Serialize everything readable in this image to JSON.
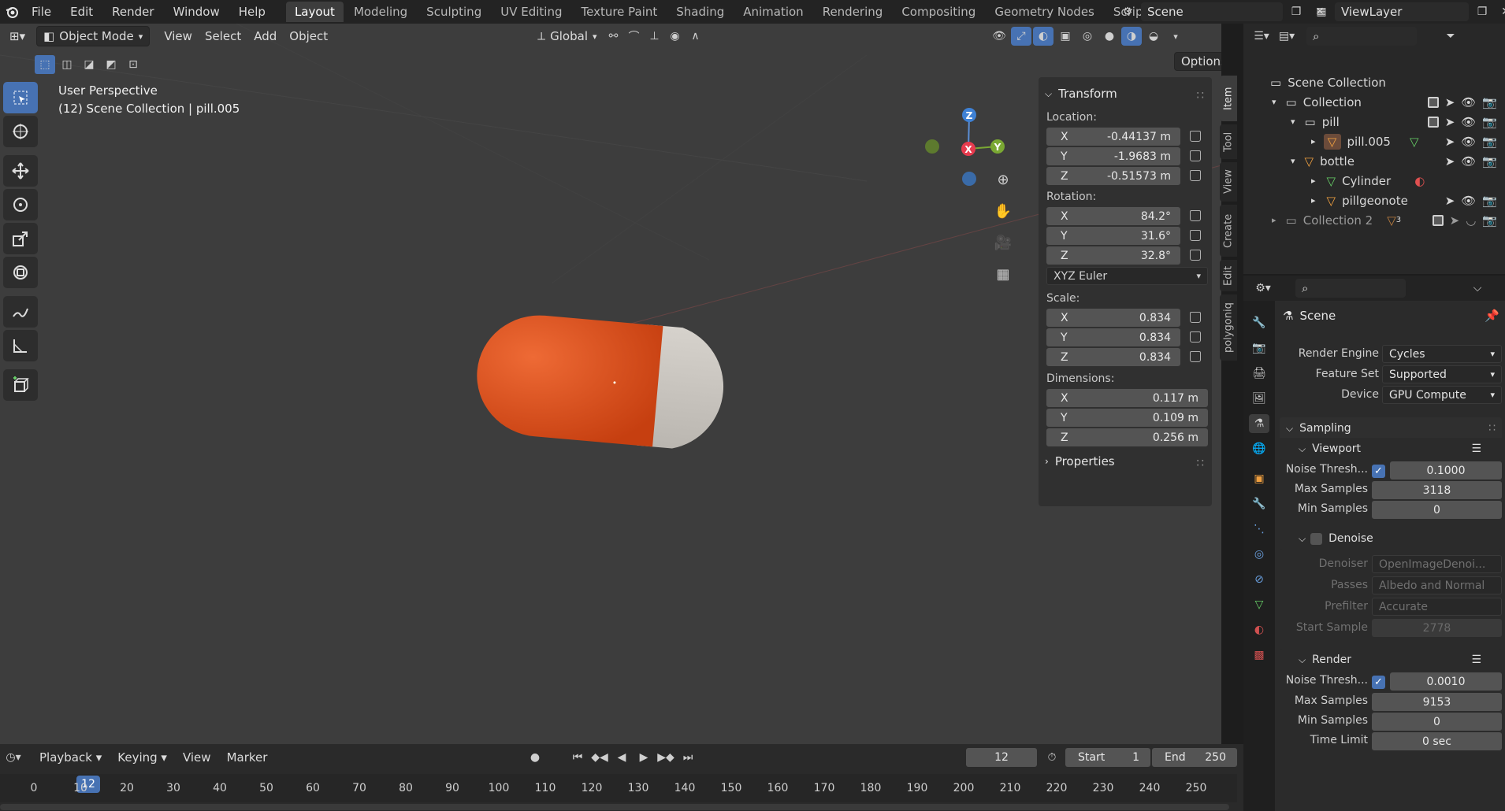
{
  "topbar": {
    "menus": [
      "File",
      "Edit",
      "Render",
      "Window",
      "Help"
    ],
    "workspaces": [
      "Layout",
      "Modeling",
      "Sculpting",
      "UV Editing",
      "Texture Paint",
      "Shading",
      "Animation",
      "Rendering",
      "Compositing",
      "Geometry Nodes",
      "Scripting"
    ],
    "active_workspace": "Layout",
    "scene": "Scene",
    "view_layer": "ViewLayer"
  },
  "viewport": {
    "mode": "Object Mode",
    "menus": [
      "View",
      "Select",
      "Add",
      "Object"
    ],
    "orientation": "Global",
    "options": "Options",
    "overlay_line1": "User Perspective",
    "overlay_line2": "(12) Scene Collection | pill.005",
    "gizmo": {
      "x": "X",
      "y": "Y",
      "z": "Z"
    },
    "pill_colors": {
      "cap": "#e0501c",
      "body": "#cfcbc5"
    }
  },
  "npanel": {
    "transform_title": "Transform",
    "location_label": "Location:",
    "location": [
      {
        "axis": "X",
        "value": "-0.44137 m"
      },
      {
        "axis": "Y",
        "value": "-1.9683 m"
      },
      {
        "axis": "Z",
        "value": "-0.51573 m"
      }
    ],
    "rotation_label": "Rotation:",
    "rotation": [
      {
        "axis": "X",
        "value": "84.2°"
      },
      {
        "axis": "Y",
        "value": "31.6°"
      },
      {
        "axis": "Z",
        "value": "32.8°"
      }
    ],
    "rotation_mode": "XYZ Euler",
    "scale_label": "Scale:",
    "scale": [
      {
        "axis": "X",
        "value": "0.834"
      },
      {
        "axis": "Y",
        "value": "0.834"
      },
      {
        "axis": "Z",
        "value": "0.834"
      }
    ],
    "dimensions_label": "Dimensions:",
    "dimensions": [
      {
        "axis": "X",
        "value": "0.117 m"
      },
      {
        "axis": "Y",
        "value": "0.109 m"
      },
      {
        "axis": "Z",
        "value": "0.256 m"
      }
    ],
    "properties_title": "Properties",
    "side_tabs": [
      "Item",
      "Tool",
      "View",
      "Create",
      "Edit",
      "polygoniq"
    ]
  },
  "outliner": {
    "root": "Scene Collection",
    "items": [
      {
        "label": "Collection"
      },
      {
        "label": "pill"
      },
      {
        "label": "pill.005"
      },
      {
        "label": "bottle"
      },
      {
        "label": "Cylinder"
      },
      {
        "label": "pillgeonote"
      },
      {
        "label": "Collection 2"
      }
    ],
    "collection2_count": "3"
  },
  "properties": {
    "context": "Scene",
    "render_engine_label": "Render Engine",
    "render_engine": "Cycles",
    "feature_set_label": "Feature Set",
    "feature_set": "Supported",
    "device_label": "Device",
    "device": "GPU Compute",
    "sampling": "Sampling",
    "viewport": "Viewport",
    "vp_noise_label": "Noise Thresh...",
    "vp_noise": "0.1000",
    "vp_max_label": "Max Samples",
    "vp_max": "3118",
    "vp_min_label": "Min Samples",
    "vp_min": "0",
    "denoise": "Denoise",
    "denoiser_label": "Denoiser",
    "denoiser": "OpenImageDenoi...",
    "passes_label": "Passes",
    "passes": "Albedo and Normal",
    "prefilter_label": "Prefilter",
    "prefilter": "Accurate",
    "start_sample_label": "Start Sample",
    "start_sample": "2778",
    "render": "Render",
    "r_noise_label": "Noise Thresh...",
    "r_noise": "0.0010",
    "r_max_label": "Max Samples",
    "r_max": "9153",
    "r_min_label": "Min Samples",
    "r_min": "0",
    "time_limit_label": "Time Limit",
    "time_limit": "0 sec"
  },
  "timeline": {
    "menus": [
      "Playback",
      "Keying",
      "View",
      "Marker"
    ],
    "current_frame": "12",
    "start_label": "Start",
    "start": "1",
    "end_label": "End",
    "end": "250",
    "ruler": [
      "0",
      "10",
      "20",
      "30",
      "40",
      "50",
      "60",
      "70",
      "80",
      "90",
      "100",
      "110",
      "120",
      "130",
      "140",
      "150",
      "160",
      "170",
      "180",
      "190",
      "200",
      "210",
      "220",
      "230",
      "240",
      "250"
    ]
  }
}
